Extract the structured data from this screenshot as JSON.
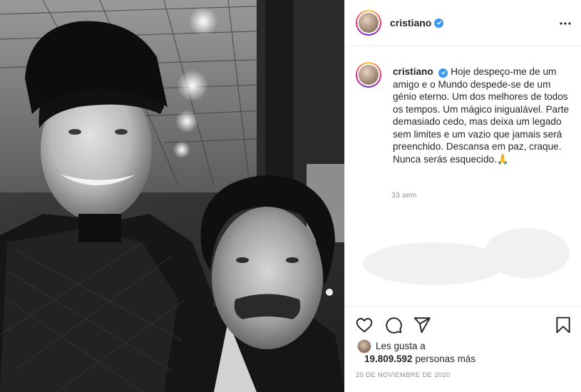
{
  "post": {
    "image_alt": "photo-two-men-selfie"
  },
  "header": {
    "username": "cristiano",
    "verified_icon": "verified-badge-icon",
    "more_icon": "more-options-icon"
  },
  "caption": {
    "username": "cristiano",
    "text": "Hoje despeço-me de um amigo e o Mundo despede-se de um génio eterno. Um dos melhores de todos os tempos. Um mágico inigualável. Parte demasiado cedo, mas deixa um legado sem limites e um vazio que jamais será preenchido. Descansa em paz, craque. Nunca serás esquecido.🙏",
    "time": "33 sem"
  },
  "actions": {
    "like_icon": "heart-icon",
    "comment_icon": "comment-icon",
    "share_icon": "share-icon",
    "save_icon": "bookmark-icon"
  },
  "likes": {
    "label": "Les gusta a",
    "count": "19.809.592",
    "suffix": "personas más"
  },
  "date": "25 DE NOVIEMBRE DE 2020",
  "colors": {
    "verified": "#3897f0",
    "text_primary": "#262626",
    "text_secondary": "#8e8e8e",
    "border": "#efefef"
  }
}
